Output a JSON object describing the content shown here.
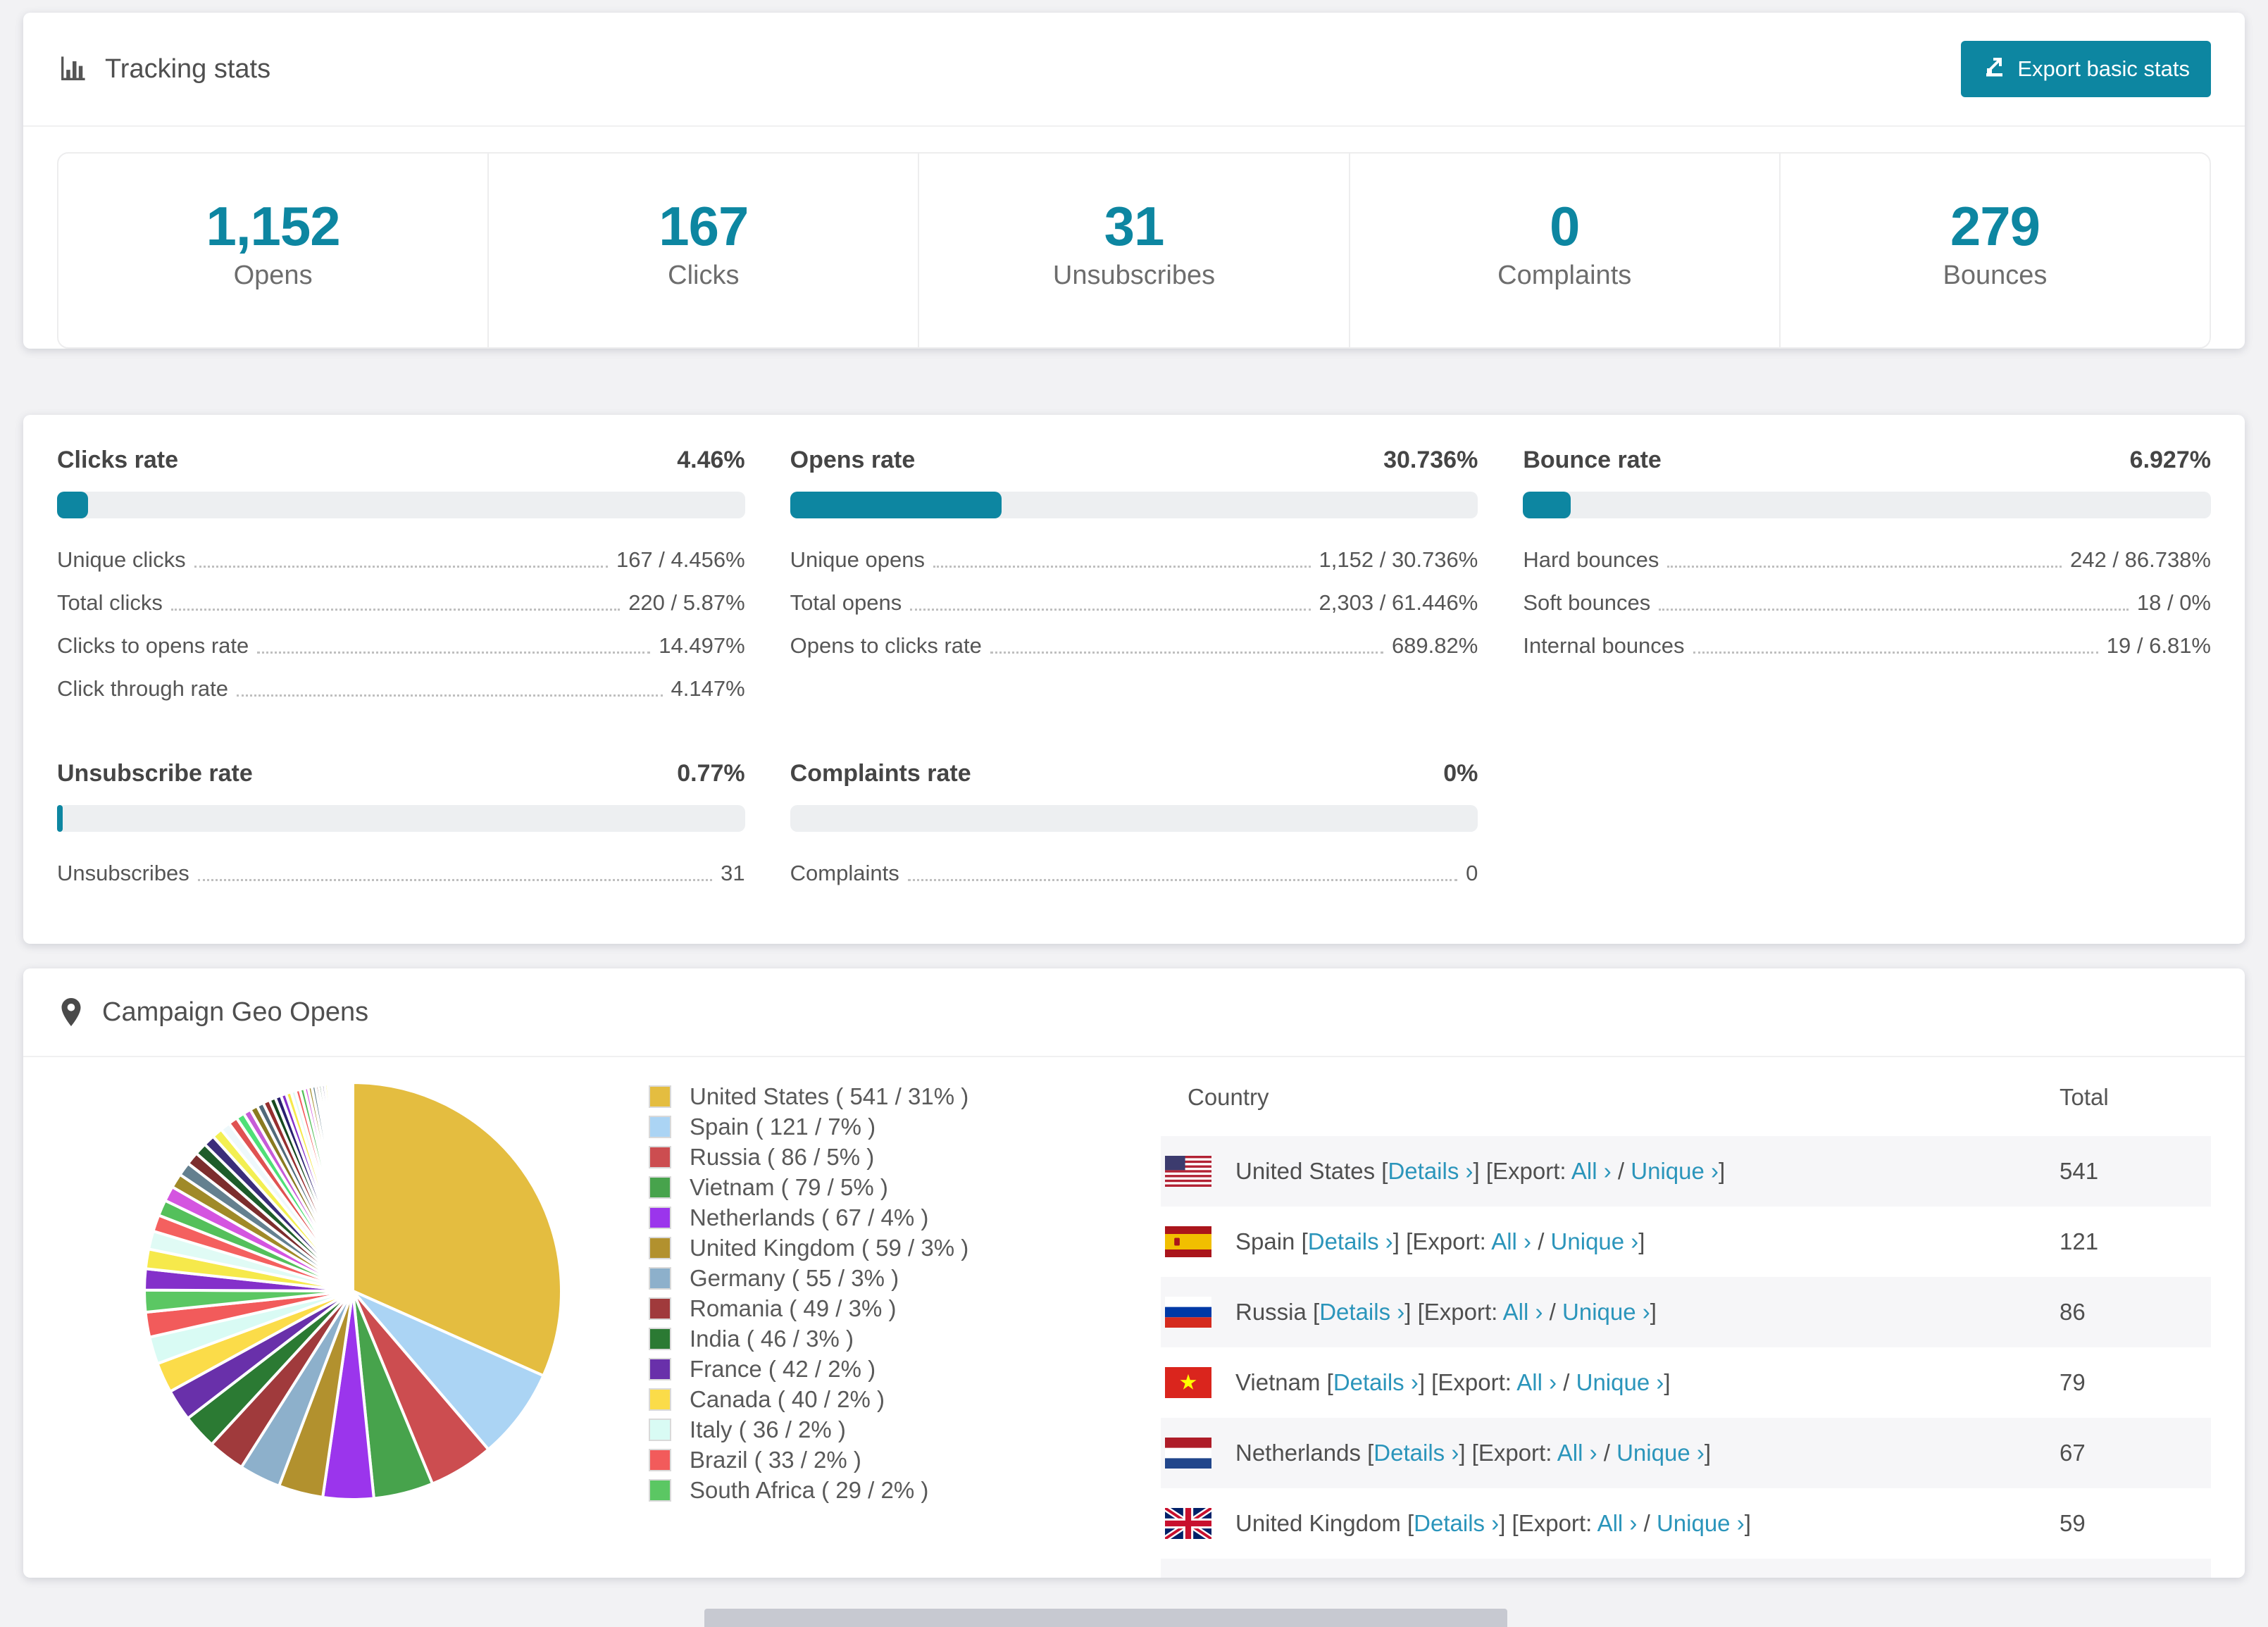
{
  "colors": {
    "accent_teal": "#0d86a1",
    "link_teal": "#2b95bb",
    "bar_track": "#edeff1",
    "row_stripe": "#f6f6f8",
    "page_background": "#f2f2f4"
  },
  "tracking": {
    "title": "Tracking stats",
    "export_button": "Export basic stats",
    "stats": [
      {
        "value": "1,152",
        "label": "Opens"
      },
      {
        "value": "167",
        "label": "Clicks"
      },
      {
        "value": "31",
        "label": "Unsubscribes"
      },
      {
        "value": "0",
        "label": "Complaints"
      },
      {
        "value": "279",
        "label": "Bounces"
      }
    ]
  },
  "rates": [
    {
      "title": "Clicks rate",
      "value": "4.46%",
      "percent": 4.46,
      "rows": [
        {
          "label": "Unique clicks",
          "value": "167 / 4.456%"
        },
        {
          "label": "Total clicks",
          "value": "220 / 5.87%"
        },
        {
          "label": "Clicks to opens rate",
          "value": "14.497%"
        },
        {
          "label": "Click through rate",
          "value": "4.147%"
        }
      ]
    },
    {
      "title": "Opens rate",
      "value": "30.736%",
      "percent": 30.736,
      "rows": [
        {
          "label": "Unique opens",
          "value": "1,152 / 30.736%"
        },
        {
          "label": "Total opens",
          "value": "2,303 / 61.446%"
        },
        {
          "label": "Opens to clicks rate",
          "value": "689.82%"
        }
      ]
    },
    {
      "title": "Bounce rate",
      "value": "6.927%",
      "percent": 6.927,
      "rows": [
        {
          "label": "Hard bounces",
          "value": "242 / 86.738%"
        },
        {
          "label": "Soft bounces",
          "value": "18 / 0%"
        },
        {
          "label": "Internal bounces",
          "value": "19 / 6.81%"
        }
      ]
    },
    {
      "title": "Unsubscribe rate",
      "value": "0.77%",
      "percent": 0.77,
      "rows": [
        {
          "label": "Unsubscribes",
          "value": "31"
        }
      ]
    },
    {
      "title": "Complaints rate",
      "value": "0%",
      "percent": 0,
      "rows": [
        {
          "label": "Complaints",
          "value": "0"
        }
      ]
    }
  ],
  "geo": {
    "title": "Campaign Geo Opens",
    "legend": [
      {
        "label": "United States ( 541 / 31% )",
        "color": "#e4bd40"
      },
      {
        "label": "Spain ( 121 / 7% )",
        "color": "#abd4f4"
      },
      {
        "label": "Russia ( 86 / 5% )",
        "color": "#cc4d50"
      },
      {
        "label": "Vietnam ( 79 / 5% )",
        "color": "#47a34c"
      },
      {
        "label": "Netherlands ( 67 / 4% )",
        "color": "#9b35ec"
      },
      {
        "label": "United Kingdom ( 59 / 3% )",
        "color": "#b2912e"
      },
      {
        "label": "Germany ( 55 / 3% )",
        "color": "#8db0cb"
      },
      {
        "label": "Romania ( 49 / 3% )",
        "color": "#a03a3c"
      },
      {
        "label": "India ( 46 / 3% )",
        "color": "#2b7a33"
      },
      {
        "label": "France ( 42 / 2% )",
        "color": "#6930aa"
      },
      {
        "label": "Canada ( 40 / 2% )",
        "color": "#fbdc49"
      },
      {
        "label": "Italy ( 36 / 2% )",
        "color": "#d9fbf4"
      },
      {
        "label": "Brazil ( 33 / 2% )",
        "color": "#f25b5b"
      },
      {
        "label": "South Africa ( 29 / 2% )",
        "color": "#5bc763"
      }
    ],
    "table": {
      "headers": [
        "Country",
        "Total"
      ],
      "link_details": "Details ›",
      "export_prefix": "Export:",
      "link_all": "All ›",
      "link_unique": "Unique ›",
      "rows": [
        {
          "country": "United States",
          "flag": "us",
          "total": "541",
          "partial": false
        },
        {
          "country": "Spain",
          "flag": "es",
          "total": "121",
          "partial": false
        },
        {
          "country": "Russia",
          "flag": "ru",
          "total": "86",
          "partial": false
        },
        {
          "country": "Vietnam",
          "flag": "vn",
          "total": "79",
          "partial": false
        },
        {
          "country": "Netherlands",
          "flag": "nl",
          "total": "67",
          "partial": false
        },
        {
          "country": "United Kingdom",
          "flag": "gb",
          "total": "59",
          "partial": false
        },
        {
          "country": "",
          "flag": "de",
          "total": "",
          "partial": true
        }
      ]
    }
  },
  "chart_data": {
    "type": "pie",
    "title": "Campaign Geo Opens",
    "legend_position": "right",
    "start_angle_deg": -90,
    "direction": "clockwise",
    "slices": [
      {
        "label": "United States",
        "value": 541,
        "pct": 31,
        "color": "#e4bd40"
      },
      {
        "label": "Spain",
        "value": 121,
        "pct": 7,
        "color": "#abd4f4"
      },
      {
        "label": "Russia",
        "value": 86,
        "pct": 5,
        "color": "#cc4d50"
      },
      {
        "label": "Vietnam",
        "value": 79,
        "pct": 5,
        "color": "#47a34c"
      },
      {
        "label": "Netherlands",
        "value": 67,
        "pct": 4,
        "color": "#9b35ec"
      },
      {
        "label": "United Kingdom",
        "value": 59,
        "pct": 3,
        "color": "#b2912e"
      },
      {
        "label": "Germany",
        "value": 55,
        "pct": 3,
        "color": "#8db0cb"
      },
      {
        "label": "Romania",
        "value": 49,
        "pct": 3,
        "color": "#a03a3c"
      },
      {
        "label": "India",
        "value": 46,
        "pct": 3,
        "color": "#2b7a33"
      },
      {
        "label": "France",
        "value": 42,
        "pct": 2,
        "color": "#6930aa"
      },
      {
        "label": "Canada",
        "value": 40,
        "pct": 2,
        "color": "#fbdc49"
      },
      {
        "label": "Italy",
        "value": 36,
        "pct": 2,
        "color": "#d9fbf4"
      },
      {
        "label": "Brazil",
        "value": 33,
        "pct": 2,
        "color": "#f25b5b"
      },
      {
        "label": "South Africa",
        "value": 29,
        "pct": 2,
        "color": "#5bc763"
      }
    ],
    "others_tail": {
      "note": "long tail of small unlabeled slices",
      "values": [
        28,
        26,
        24,
        22,
        21,
        20,
        19,
        18,
        17,
        16,
        15,
        14,
        13,
        12,
        11,
        10,
        10,
        9,
        9,
        8,
        8,
        7,
        7,
        6,
        6,
        6,
        5,
        5,
        5,
        4,
        4,
        4,
        4,
        3,
        3,
        3,
        3,
        3,
        2,
        2,
        2,
        2,
        2,
        2,
        1,
        1,
        1,
        1,
        1,
        1
      ],
      "palette": [
        "#8430ca",
        "#f6e94b",
        "#e0fbf5",
        "#f4605f",
        "#54c05b",
        "#d455e0",
        "#a08a28",
        "#64808f",
        "#7c2d2d",
        "#1e5c2a",
        "#3b2d7a",
        "#f3ef52",
        "#eef8fb",
        "#e05252",
        "#4fe077",
        "#c65bd8",
        "#8a7a20",
        "#506a7a",
        "#962f2f",
        "#16491f",
        "#2a2070"
      ]
    }
  }
}
